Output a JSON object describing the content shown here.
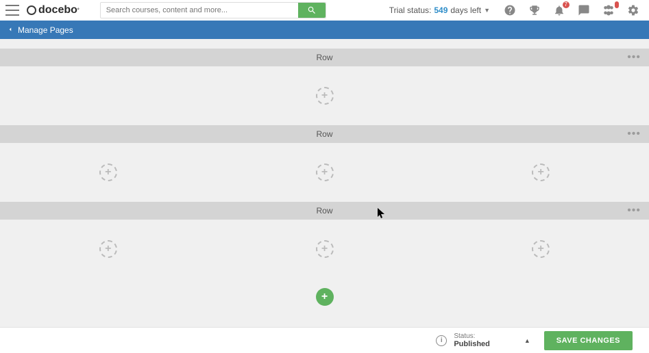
{
  "header": {
    "logo_text": "docebo",
    "search_placeholder": "Search courses, content and more...",
    "trial_prefix": "Trial status:",
    "trial_days": "549",
    "trial_suffix": "days left",
    "notif_badge": "7"
  },
  "page_header": {
    "back_label": "Manage Pages"
  },
  "rows": [
    {
      "label": "Row",
      "columns": 1
    },
    {
      "label": "Row",
      "columns": 3
    },
    {
      "label": "Row",
      "columns": 3
    }
  ],
  "footer": {
    "status_label": "Status:",
    "status_value": "Published",
    "save_label": "SAVE CHANGES"
  }
}
